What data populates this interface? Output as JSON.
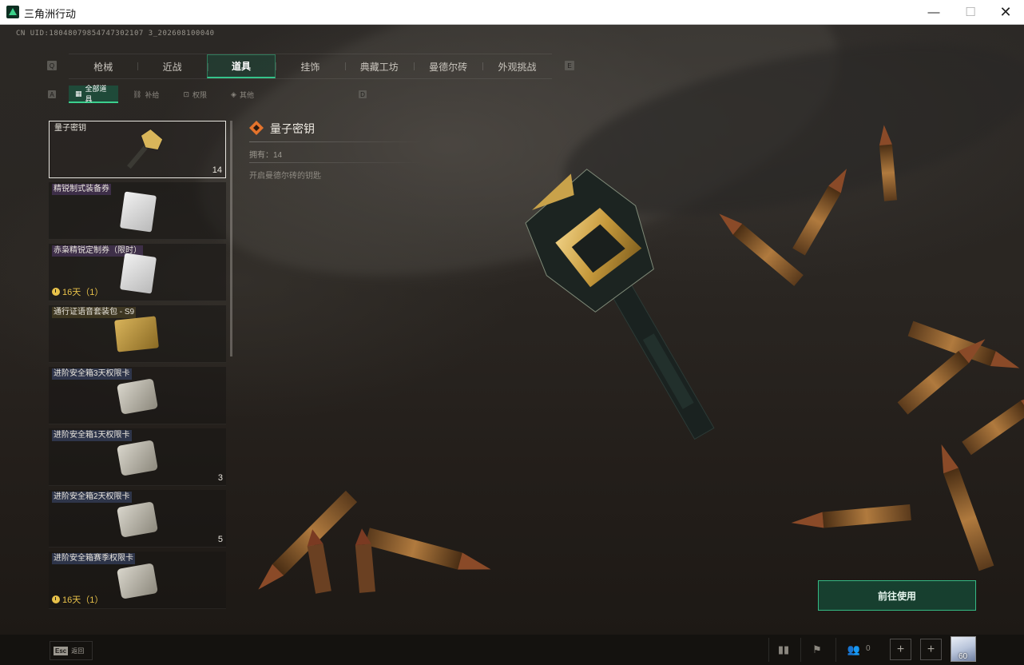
{
  "window": {
    "title": "三角洲行动",
    "minimize": "—",
    "maximize": "☐",
    "close": "✕"
  },
  "uid": "CN UID:18048079854747302107 3_202608100040",
  "main_tabs": [
    {
      "label": "枪械",
      "active": false
    },
    {
      "label": "近战",
      "active": false
    },
    {
      "label": "道具",
      "active": true
    },
    {
      "label": "挂饰",
      "active": false
    },
    {
      "label": "典藏工坊",
      "active": false
    },
    {
      "label": "曼德尔砖",
      "active": false
    },
    {
      "label": "外观挑战",
      "active": false
    }
  ],
  "key_hints": {
    "tabs_left": "Q",
    "tabs_right": "E",
    "sub_left": "A",
    "sub_right": "D"
  },
  "sub_tabs": [
    {
      "label": "全部道具",
      "icon": "grid-icon",
      "active": true
    },
    {
      "label": "补给",
      "icon": "supply-icon",
      "active": false
    },
    {
      "label": "权限",
      "icon": "lock-icon",
      "active": false
    },
    {
      "label": "其他",
      "icon": "diamond-icon",
      "active": false
    }
  ],
  "items": [
    {
      "name": "量子密钥",
      "count": "14",
      "timer": "",
      "selected": true,
      "type": "key",
      "tag": "plain"
    },
    {
      "name": "精锐制式装备券",
      "count": "",
      "timer": "",
      "selected": false,
      "type": "bag",
      "tag": "purple"
    },
    {
      "name": "赤枭精锐定制券（限时）",
      "count": "",
      "timer": "16天（1）",
      "selected": false,
      "type": "bag",
      "tag": "purple"
    },
    {
      "name": "通行证语音套装包 - S9",
      "count": "",
      "timer": "",
      "selected": false,
      "type": "gold-box",
      "tag": "plain"
    },
    {
      "name": "进阶安全箱3天权限卡",
      "count": "",
      "timer": "",
      "selected": false,
      "type": "card",
      "tag": "blue"
    },
    {
      "name": "进阶安全箱1天权限卡",
      "count": "3",
      "timer": "",
      "selected": false,
      "type": "card",
      "tag": "blue"
    },
    {
      "name": "进阶安全箱2天权限卡",
      "count": "5",
      "timer": "",
      "selected": false,
      "type": "card",
      "tag": "blue"
    },
    {
      "name": "进阶安全箱赛季权限卡",
      "count": "",
      "timer": "16天（1）",
      "selected": false,
      "type": "card",
      "tag": "blue"
    }
  ],
  "detail": {
    "title": "量子密钥",
    "owned": "拥有：14",
    "description": "开启曼德尔砖的钥匙"
  },
  "use_button": "前往使用",
  "bottom": {
    "esc_key": "Esc",
    "esc_label": "返回",
    "friend_count": "0",
    "avatar_level": "60"
  },
  "colors": {
    "accent": "#35c38a",
    "timer": "#e7c14a",
    "tab_active_bg": "#1f4a39"
  }
}
